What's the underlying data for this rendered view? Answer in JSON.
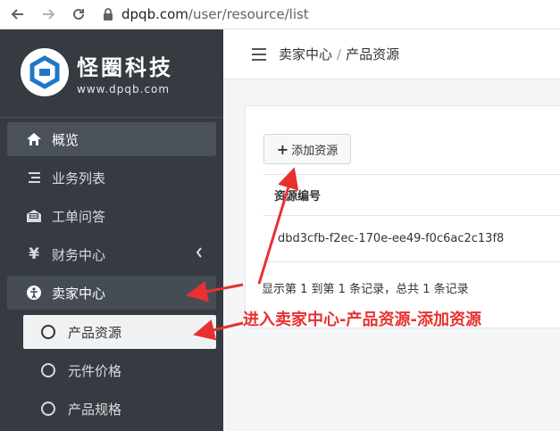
{
  "browser": {
    "back_icon": "arrow-left-icon",
    "forward_icon": "arrow-right-icon",
    "reload_icon": "reload-icon",
    "url_host": "dpqb.com",
    "url_path": "/user/resource/list"
  },
  "brand": {
    "name": "怪圈科技",
    "url": "www.dpqb.com",
    "accent": "#1e78c8"
  },
  "sidebar": {
    "items": [
      {
        "label": "概览",
        "icon": "home-icon"
      },
      {
        "label": "业务列表",
        "icon": "list-icon"
      },
      {
        "label": "工单问答",
        "icon": "envelope-open-icon"
      },
      {
        "label": "财务中心",
        "icon": "yen-icon"
      },
      {
        "label": "卖家中心",
        "icon": "person-circle-icon"
      }
    ],
    "sub_items": [
      {
        "label": "产品资源"
      },
      {
        "label": "元件价格"
      },
      {
        "label": "产品规格"
      }
    ]
  },
  "breadcrumb": {
    "parent": "卖家中心",
    "separator": "/",
    "current": "产品资源"
  },
  "toolbar": {
    "add_label": "添加资源"
  },
  "table": {
    "columns": [
      "资源编号"
    ],
    "rows": [
      [
        "dbd3cfb-f2ec-170e-ee49-f0c6ac2c13f8"
      ]
    ]
  },
  "pagination": {
    "summary": "显示第 1 到第 1 条记录，总共 1 条记录"
  },
  "annotation": {
    "text": "进入卖家中心-产品资源-添加资源",
    "color": "#e8312f"
  }
}
